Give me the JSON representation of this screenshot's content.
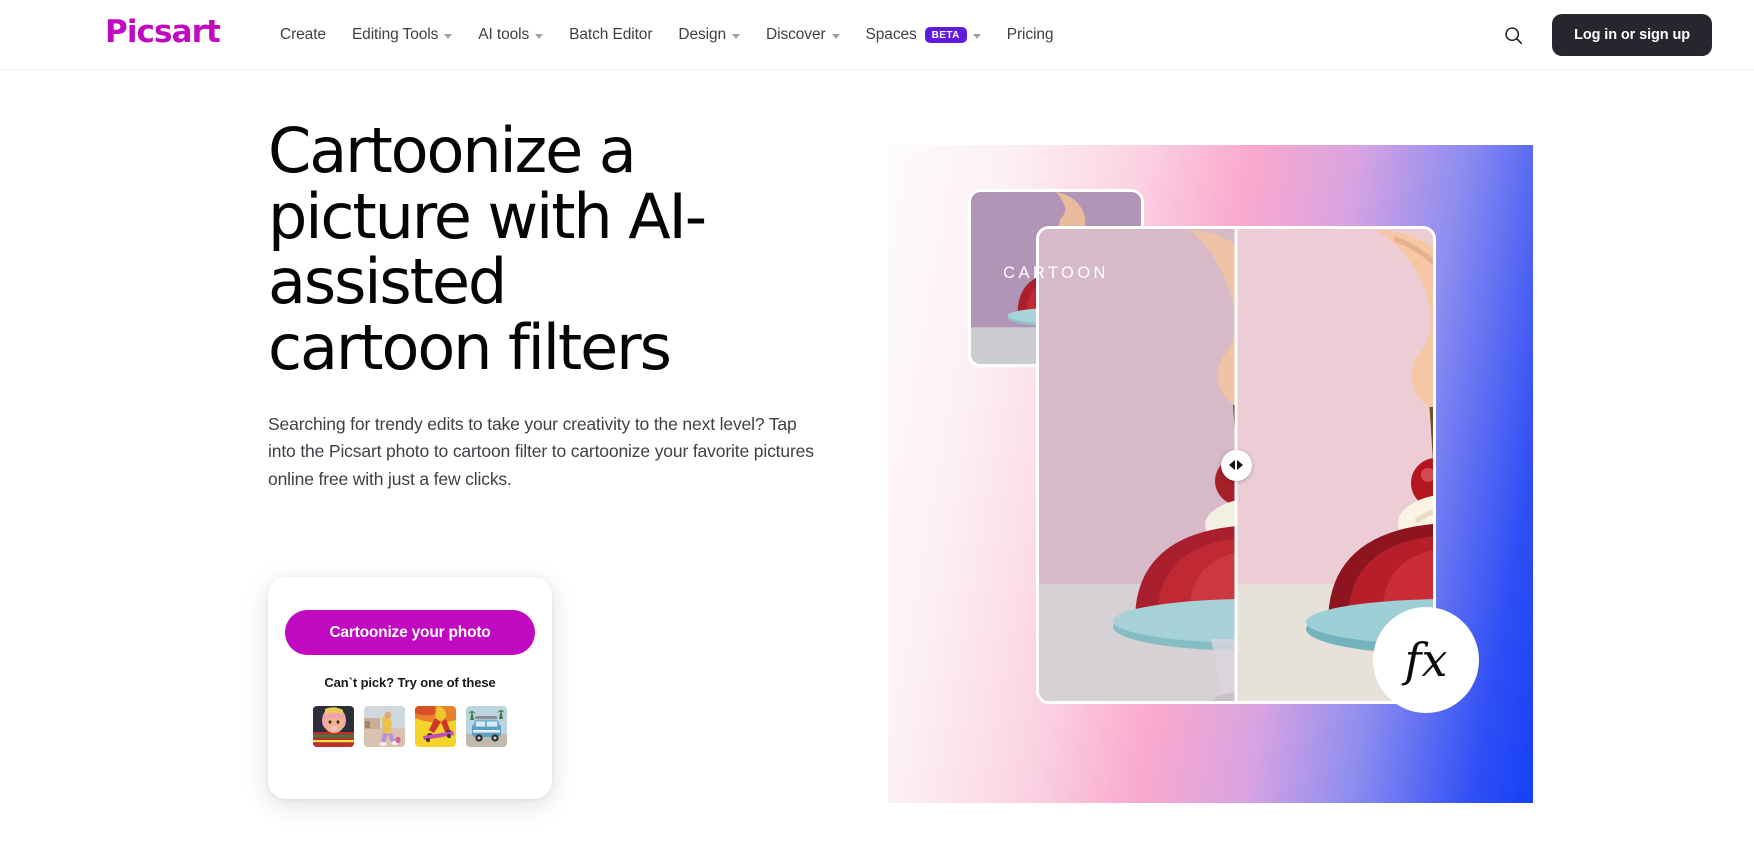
{
  "brand": {
    "logo_text": "Picsart",
    "logo_color": "#C209C2"
  },
  "header": {
    "nav": [
      {
        "label": "Create",
        "has_dropdown": false,
        "badge": null
      },
      {
        "label": "Editing Tools",
        "has_dropdown": true,
        "badge": null
      },
      {
        "label": "AI tools",
        "has_dropdown": true,
        "badge": null
      },
      {
        "label": "Batch Editor",
        "has_dropdown": false,
        "badge": null
      },
      {
        "label": "Design",
        "has_dropdown": true,
        "badge": null
      },
      {
        "label": "Discover",
        "has_dropdown": true,
        "badge": null
      },
      {
        "label": "Spaces",
        "has_dropdown": true,
        "badge": "BETA"
      },
      {
        "label": "Pricing",
        "has_dropdown": false,
        "badge": null
      }
    ],
    "search_icon": "search-icon",
    "login_label": "Log in or sign up",
    "login_bg": "#26262E",
    "beta_badge_bg": "#6119DE"
  },
  "hero": {
    "headline": "Cartoonize a picture with AI-assisted cartoon filters",
    "subcopy": "Searching for trendy edits to take your creativity to the next level? Tap into the Picsart photo to cartoon filter to cartoonize your favorite pictures online free with just a few clicks.",
    "cta": {
      "button_label": "Cartoonize your photo",
      "button_bg": "#C209C2",
      "hint_label": "Can`t pick? Try one of these",
      "thumbnails": [
        {
          "name": "portrait-pink-hair"
        },
        {
          "name": "person-bending-street"
        },
        {
          "name": "skateboarder-yellow"
        },
        {
          "name": "blue-vw-bus"
        }
      ]
    },
    "visual": {
      "cartoon_card_label": "CARTOON",
      "fx_badge_label": "fx",
      "slider_left_arrow": "arrow-left-icon",
      "slider_right_arrow": "arrow-right-icon",
      "gradient_from": "#fdfbfc",
      "gradient_mid": "#f9a9cd",
      "gradient_to": "#1540f7"
    }
  }
}
